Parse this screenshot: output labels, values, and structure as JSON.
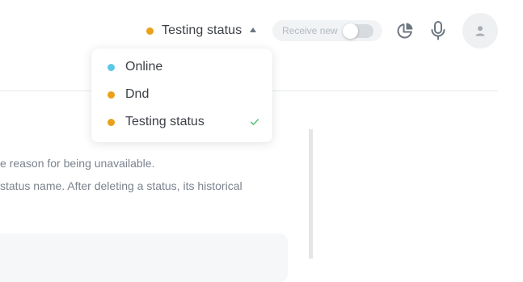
{
  "header": {
    "current_status": {
      "label": "Testing status",
      "color": "#e9a11a"
    },
    "receive_new": {
      "label": "Receive new",
      "enabled": false
    },
    "icons": {
      "stats": "pie-chart-icon",
      "microphone": "microphone-icon",
      "avatar": "user-icon"
    }
  },
  "status_menu": {
    "items": [
      {
        "label": "Online",
        "color": "#5bc8e6",
        "selected": false
      },
      {
        "label": "Dnd",
        "color": "#e9a11a",
        "selected": false
      },
      {
        "label": "Testing status",
        "color": "#e9a11a",
        "selected": true
      }
    ],
    "selected_icon": "check-icon"
  },
  "content": {
    "line1": "e reason for being unavailable.",
    "line2": "status name. After deleting a status, its historical"
  },
  "colors": {
    "accent_check": "#5cc079"
  }
}
